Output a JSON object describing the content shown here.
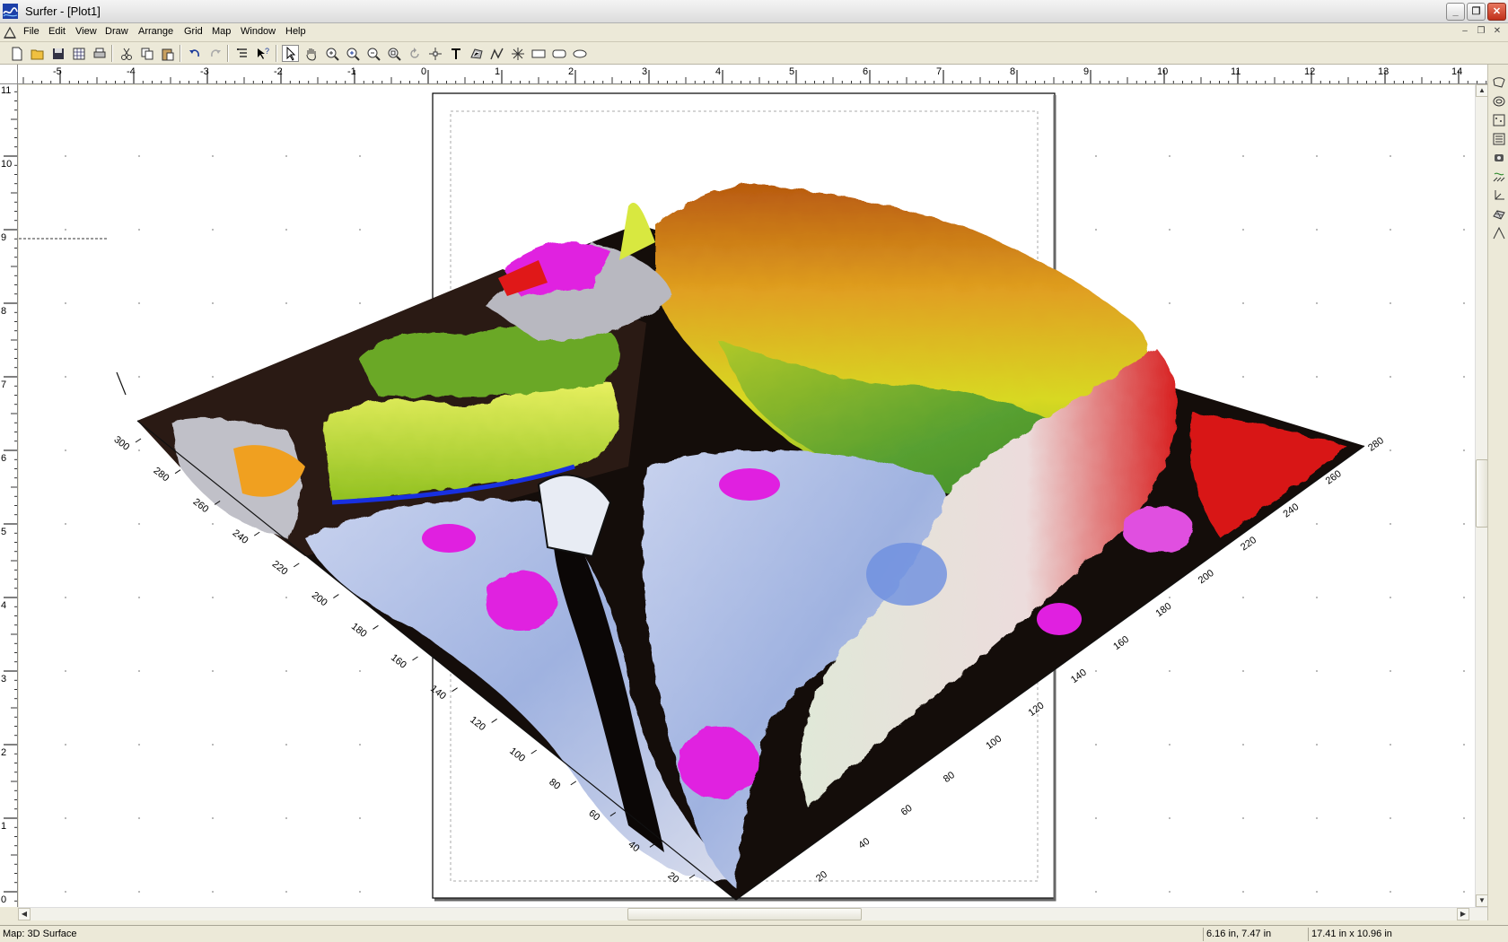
{
  "window": {
    "title": "Surfer - [Plot1]",
    "minimize": "_",
    "restore": "❐",
    "close": "✕"
  },
  "menubar": {
    "items": [
      "File",
      "Edit",
      "View",
      "Draw",
      "Arrange",
      "Grid",
      "Map",
      "Window",
      "Help"
    ],
    "mdi_minimize": "–",
    "mdi_restore": "❐",
    "mdi_close": "✕"
  },
  "toolbar": {
    "buttons": [
      "new",
      "open",
      "save",
      "worksheet",
      "print",
      "cut",
      "copy",
      "paste",
      "undo",
      "redo",
      "object-manager",
      "whats-this",
      "select",
      "pan",
      "zoom-in",
      "zoom-realtime",
      "zoom-out",
      "zoom-fit",
      "rotate",
      "reshape",
      "text",
      "polyline",
      "polygon",
      "symbol",
      "rectangle",
      "rounded-rectangle",
      "ellipse"
    ]
  },
  "rulers": {
    "horizontal_labels": [
      "-5",
      "-4",
      "-3",
      "-2",
      "-1",
      "0",
      "1",
      "2",
      "3",
      "4",
      "5",
      "6",
      "7",
      "8",
      "9",
      "10",
      "11",
      "12",
      "13",
      "14"
    ],
    "vertical_labels": [
      "11",
      "10",
      "9",
      "8",
      "7",
      "6",
      "5",
      "4",
      "3",
      "2",
      "1",
      "0"
    ]
  },
  "plot": {
    "map_type": "3D Surface",
    "left_axis_labels": [
      "300",
      "280",
      "260",
      "240",
      "220",
      "200",
      "180",
      "160",
      "140",
      "120",
      "100",
      "80",
      "60",
      "40",
      "20"
    ],
    "right_axis_labels": [
      "20",
      "40",
      "60",
      "80",
      "100",
      "120",
      "140",
      "160",
      "180",
      "200",
      "220",
      "240",
      "260",
      "280"
    ]
  },
  "statusbar": {
    "selection": "Map: 3D Surface",
    "cursor_position": "6.16 in, 7.47 in",
    "page_size": "17.41 in x 10.96 in"
  },
  "colors": {
    "surface_high": "#d08020",
    "surface_mid": "#c8e020",
    "surface_green": "#60b030",
    "surface_low": "#aab8e0",
    "accent_magenta": "#e020e0",
    "accent_red": "#e01818",
    "accent_blue": "#1830e0"
  }
}
